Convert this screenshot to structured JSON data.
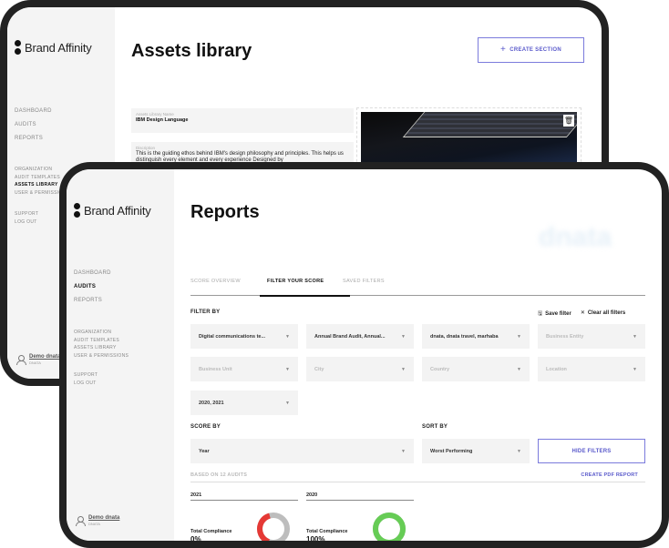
{
  "back_screen": {
    "brand": "Brand Affinity",
    "page_title": "Assets library",
    "create_section_label": "CREATE SECTION",
    "nav_main": [
      "DASHBOARD",
      "AUDITS",
      "REPORTS"
    ],
    "nav_sub": [
      "ORGANIZATION",
      "AUDIT TEMPLATES",
      "ASSETS LIBRARY",
      "USER & PERMISSIONS"
    ],
    "nav_sub_active": "ASSETS LIBRARY",
    "nav_support": [
      "SUPPORT",
      "LOG OUT"
    ],
    "user": {
      "name": "Demo dnata",
      "org": "DNATA"
    },
    "library_name_label": "Assets Library Name",
    "library_name_value": "IBM Design Language",
    "description_label": "Discription",
    "description_value": "This is the guiding ethos behind IBM's design philosophy and principles. This helps us distinguish every element and every experience Designed by"
  },
  "front_screen": {
    "brand": "Brand Affinity",
    "page_title": "Reports",
    "watermark": "dnata",
    "nav_main": [
      "DASHBOARD",
      "AUDITS",
      "REPORTS"
    ],
    "nav_main_active": "AUDITS",
    "nav_sub": [
      "ORGANIZATION",
      "AUDIT TEMPLATES",
      "ASSETS LIBRARY",
      "USER & PERMISSIONS"
    ],
    "nav_support": [
      "SUPPORT",
      "LOG OUT"
    ],
    "user": {
      "name": "Demo dnata",
      "org": "DNATA"
    },
    "tabs": [
      {
        "label": "SCORE OVERVIEW",
        "active": false
      },
      {
        "label": "FILTER YOUR SCORE",
        "active": true
      },
      {
        "label": "SAVED FILTERS",
        "active": false
      }
    ],
    "filter_by_label": "FILTER BY",
    "save_filter_label": "Save filter",
    "clear_filters_label": "Clear all filters",
    "filters": [
      {
        "value": "Digital communications te...",
        "placeholder": false
      },
      {
        "value": "Annual Brand Audit, Annual...",
        "placeholder": false
      },
      {
        "value": "dnata, dnata travel, marhaba",
        "placeholder": false
      },
      {
        "value": "Business Entity",
        "placeholder": true
      },
      {
        "value": "Business Unit",
        "placeholder": true
      },
      {
        "value": "City",
        "placeholder": true
      },
      {
        "value": "Country",
        "placeholder": true
      },
      {
        "value": "Location",
        "placeholder": true
      },
      {
        "value": "2020, 2021",
        "placeholder": false
      }
    ],
    "score_by_label": "SCORE BY",
    "score_by_value": "Year",
    "sort_by_label": "SORT BY",
    "sort_by_value": "Worst Performing",
    "hide_filters_label": "HIDE FILTERS",
    "based_on_label": "BASED ON 12 AUDITS",
    "create_pdf_label": "CREATE PDF REPORT",
    "years": [
      {
        "year": "2021",
        "compliance_label": "Total Compliance",
        "compliance_value": "0%",
        "ring_fraction": 0.4,
        "ring_color": "#e53935",
        "ring_track": "#bdbdbd"
      },
      {
        "year": "2020",
        "compliance_label": "Total Compliance",
        "compliance_value": "100%",
        "ring_fraction": 1.0,
        "ring_color": "#66cc55",
        "ring_track": "#bdbdbd"
      }
    ]
  },
  "colors": {
    "accent": "#5a5acb",
    "frame": "#222222",
    "sidebar": "#f4f4f4"
  }
}
